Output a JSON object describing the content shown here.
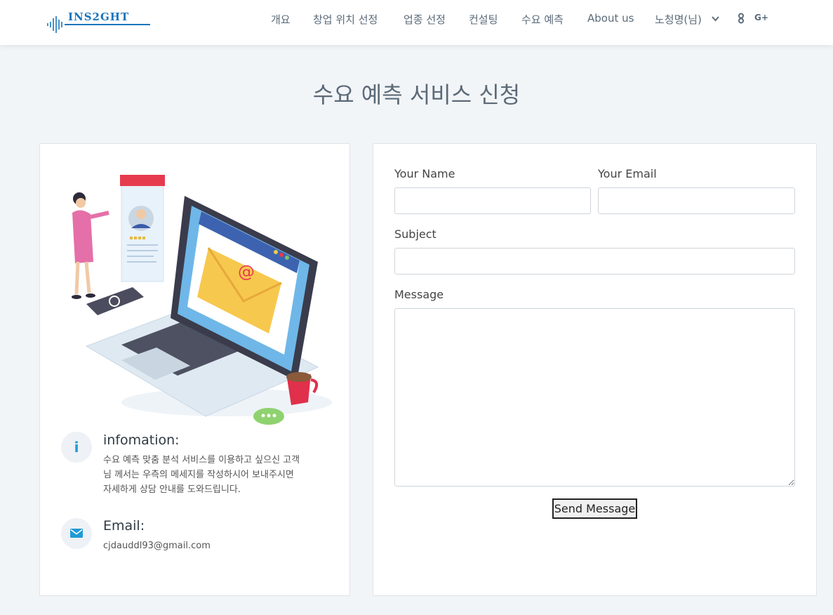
{
  "brand": {
    "logo_text": "INS2GHT"
  },
  "nav": {
    "items": [
      "개요",
      "창업 위치 선정",
      "업종 선정",
      "컨설팅",
      "수요 예측",
      "About us",
      "노청명(님)"
    ],
    "icons": [
      "chevron-down-icon",
      "github-icon",
      "google-plus-icon"
    ],
    "gplus_label": "G+"
  },
  "page": {
    "title": "수요 예측 서비스 신청"
  },
  "info": {
    "title": "infomation:",
    "text_lines": [
      "수요 예측 맞춤 분석 서비스를 이용하고 싶으신 고객",
      "님 께서는 우측의 메세지를 작성하시어 보내주시면",
      "자세하게 상담 안내를 도와드립니다."
    ],
    "icon_glyph": "i"
  },
  "email": {
    "title": "Email:",
    "address": "cjdauddl93@gmail.com"
  },
  "form": {
    "name_label": "Your Name",
    "email_label": "Your Email",
    "subject_label": "Subject",
    "message_label": "Message",
    "name_value": "",
    "email_value": "",
    "subject_value": "",
    "message_value": "",
    "send_label": "Send Message"
  },
  "colors": {
    "accent": "#1f9ad6",
    "brand": "#1b75bb",
    "background": "#f2f5f8"
  }
}
